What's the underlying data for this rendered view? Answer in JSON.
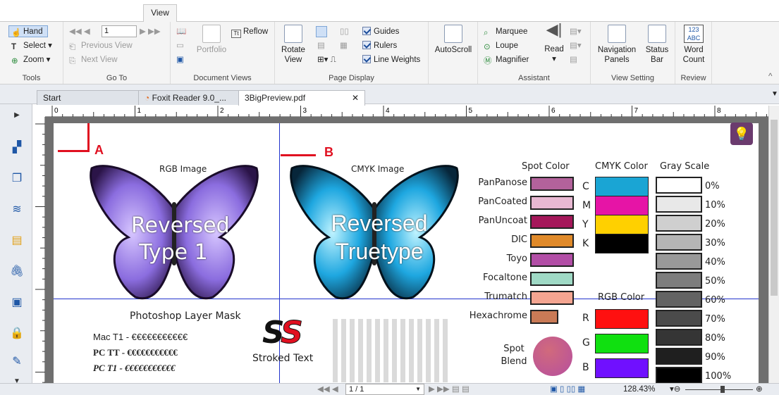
{
  "ribbon_tab": "View",
  "groups": {
    "tools": {
      "label": "Tools",
      "hand": "Hand",
      "select": "Select",
      "zoom": "Zoom"
    },
    "goto": {
      "label": "Go To",
      "page_value": "1",
      "previous": "Previous View",
      "next": "Next View"
    },
    "docviews": {
      "label": "Document Views",
      "reflow": "Reflow",
      "portfolio": "Portfolio"
    },
    "pagedisplay": {
      "label": "Page Display",
      "rotate": "Rotate View",
      "guides": "Guides",
      "rulers": "Rulers",
      "line_weights": "Line Weights"
    },
    "autoscroll": {
      "label": "AutoScroll"
    },
    "assistant": {
      "label": "Assistant",
      "marquee": "Marquee",
      "loupe": "Loupe",
      "magnifier": "Magnifier",
      "read": "Read"
    },
    "viewsetting": {
      "label": "View Setting",
      "nav_panels": "Navigation Panels",
      "status_bar": "Status Bar"
    },
    "review": {
      "label": "Review",
      "word_count": "Word Count",
      "word_icon": "123 ABC"
    }
  },
  "doc_tabs": [
    "Start",
    "Foxit Reader 9.0_...",
    "3BigPreview.pdf"
  ],
  "ruler_numbers": [
    "0",
    "1",
    "2",
    "3",
    "4",
    "5",
    "6",
    "7",
    "8"
  ],
  "page": {
    "mark_a": "A",
    "mark_b": "B",
    "rgb_image": "RGB Image",
    "cmyk_image": "CMYK Image",
    "reversed1": "Reversed",
    "type1": "Type 1",
    "reversed2": "Reversed",
    "truetype": "Truetype",
    "layer_mask": "Photoshop Layer Mask",
    "spot_color": "Spot Color",
    "cmyk_color": "CMYK Color",
    "gray_scale": "Gray Scale",
    "rgb_color": "RGB Color",
    "spots": [
      {
        "name": "PanPanose",
        "color": "#b3629b"
      },
      {
        "name": "PanCoated",
        "color": "#e8b8d2"
      },
      {
        "name": "PanUncoat",
        "color": "#a5175a"
      },
      {
        "name": "DIC",
        "color": "#e08a2a"
      },
      {
        "name": "Toyo",
        "color": "#b24ea6"
      },
      {
        "name": "Focaltone",
        "color": "#9fd9c5"
      },
      {
        "name": "Trumatch",
        "color": "#f4a591"
      },
      {
        "name": "Hexachrome",
        "color": "#c97a56"
      }
    ],
    "cmyk": [
      {
        "name": "C",
        "color": "#1aa5d4"
      },
      {
        "name": "M",
        "color": "#e614a6"
      },
      {
        "name": "Y",
        "color": "#ffd000"
      },
      {
        "name": "K",
        "color": "#000000"
      }
    ],
    "rgb": [
      {
        "name": "R",
        "color": "#ff1010"
      },
      {
        "name": "G",
        "color": "#10e010"
      },
      {
        "name": "B",
        "color": "#7010ff"
      }
    ],
    "grays": [
      {
        "pct": "0%",
        "color": "#ffffff"
      },
      {
        "pct": "10%",
        "color": "#e8e8e8"
      },
      {
        "pct": "20%",
        "color": "#cfcfcf"
      },
      {
        "pct": "30%",
        "color": "#b5b5b5"
      },
      {
        "pct": "40%",
        "color": "#999999"
      },
      {
        "pct": "50%",
        "color": "#7d7d7d"
      },
      {
        "pct": "60%",
        "color": "#636363"
      },
      {
        "pct": "70%",
        "color": "#4b4b4b"
      },
      {
        "pct": "80%",
        "color": "#353535"
      },
      {
        "pct": "90%",
        "color": "#1f1f1f"
      },
      {
        "pct": "100%",
        "color": "#000000"
      }
    ],
    "spot_blend": "Spot Blend",
    "stroked": "Stroked Text",
    "ss": "SS",
    "mac_t1": "Mac T1 - €€€€€€€€€€€",
    "pc_tt": "PC TT - €€€€€€€€€€€",
    "pc_t1": "PC T1 - €€€€€€€€€€€"
  },
  "status": {
    "page": "1 / 1",
    "zoom": "128.43%"
  }
}
